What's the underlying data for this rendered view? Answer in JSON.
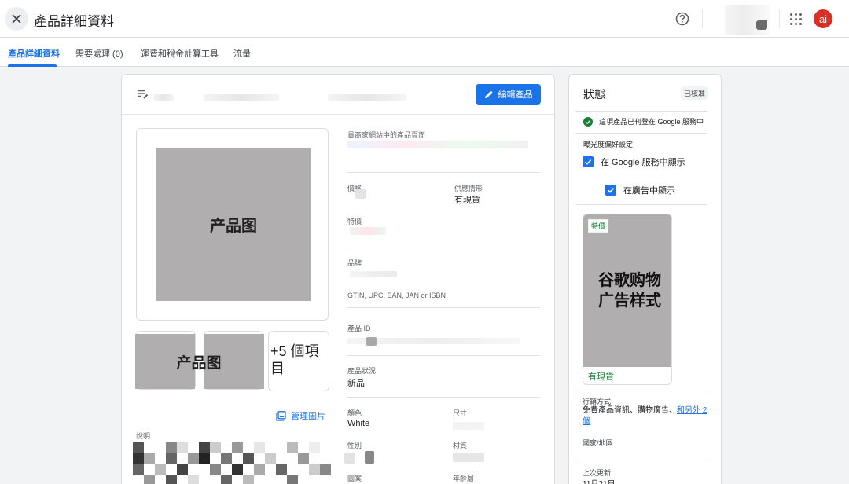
{
  "header": {
    "title": "產品詳細資料",
    "avatar_initials": "ai",
    "close_icon": "close-icon",
    "help_icon": "help-circle-icon",
    "apps_icon": "apps-grid-icon"
  },
  "tabs": [
    {
      "label": "產品詳細資料",
      "active": true
    },
    {
      "label": "需要處理 (0)",
      "active": false
    },
    {
      "label": "運費和稅金計算工具",
      "active": false
    },
    {
      "label": "流量",
      "active": false
    }
  ],
  "main": {
    "edit_label": "編輯產品",
    "image_placeholder": "产品图",
    "thumb_placeholder": "产品图",
    "more_items": "+5 個項目",
    "manage_images": "管理圖片",
    "description_label": "說明",
    "fields": {
      "merchant_page": "貴商家網站中的產品頁面",
      "price": "價格",
      "availability": "供應情形",
      "availability_value": "有現貨",
      "sale_price": "特價",
      "brand": "品牌",
      "gtin": "GTIN, UPC, EAN, JAN or ISBN",
      "product_id": "產品 ID",
      "condition": "產品狀況",
      "condition_value": "新品",
      "color": "顏色",
      "color_value": "White",
      "size": "尺寸",
      "gender": "性別",
      "material": "材質",
      "pattern": "圖案",
      "age_group": "年齡層"
    }
  },
  "status": {
    "title": "狀態",
    "badge": "已核准",
    "listed_text": "這項產品已刊登在 Google 服務中",
    "visibility_label": "曝光度偏好設定",
    "show_google": "在 Google 服務中顯示",
    "show_ads": "在廣告中顯示",
    "ad_preview_text": "谷歌购物广告样式",
    "ad_tag": "特價",
    "ad_stock": "有現貨",
    "marketing_label": "行銷方式",
    "marketing_value": "免費產品資訊、購物廣告、",
    "marketing_link": "和另外 2 個",
    "country_label": "國家/地區",
    "last_update_label": "上次更新",
    "last_update_value": "11月21日"
  },
  "colors": {
    "accent": "#1a73e8",
    "success": "#188038",
    "avatar": "#d93025",
    "placeholder": "#b0aeae"
  }
}
